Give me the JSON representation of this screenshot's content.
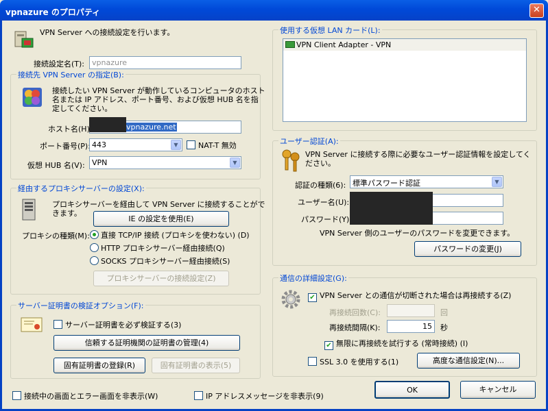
{
  "window": {
    "title": "vpnazure のプロパティ",
    "close_glyph": "✕"
  },
  "intro": "VPN Server への接続設定を行います。",
  "setting_name": {
    "label": "接続設定名(T):",
    "value": "vpnazure"
  },
  "dest": {
    "legend": "接続先 VPN Server の指定(B):",
    "desc": [
      "接続したい VPN Server が動作しているコンピュータのホスト",
      "名または IP アドレス、ポート番号、および仮想 HUB 名を指",
      "定してください。"
    ],
    "host_label": "ホスト名(H):",
    "host_value": "vpnazure.net",
    "port_label": "ポート番号(P):",
    "port_value": "443",
    "natt_label": "NAT-T 無効",
    "hub_label": "仮想 HUB 名(V):",
    "hub_value": "VPN"
  },
  "proxy": {
    "legend": "経由するプロキシサーバーの設定(X):",
    "desc": [
      "プロキシサーバーを経由して VPN Server に接続することがで",
      "きます。"
    ],
    "ie_button": "IE の設定を使用(E)",
    "type_label": "プロキシの種類(M):",
    "options": [
      "直接 TCP/IP 接続 (プロキシを使わない) (D)",
      "HTTP プロキシサーバー経由接続(Q)",
      "SOCKS プロキシサーバー経由接続(S)"
    ],
    "settings_button": "プロキシサーバーの接続設定(Z)"
  },
  "cert": {
    "legend": "サーバー証明書の検証オプション(F):",
    "verify_label": "サーバー証明書を必ず検証する(3)",
    "manage_button": "信頼する証明機関の証明書の管理(4)",
    "register_button": "固有証明書の登録(R)",
    "show_button": "固有証明書の表示(5)"
  },
  "bottom": {
    "hide_screens_label": "接続中の画面とエラー画面を非表示(W)",
    "hide_ip_label": "IP アドレスメッセージを非表示(9)"
  },
  "lan": {
    "legend": "使用する仮想 LAN カード(L):",
    "items": [
      "VPN Client Adapter - VPN"
    ]
  },
  "auth": {
    "legend": "ユーザー認証(A):",
    "desc": [
      "VPN Server に接続する際に必要なユーザー認証情報を設定してく",
      "ださい。"
    ],
    "type_label": "認証の種類(6):",
    "type_value": "標準パスワード認証",
    "user_label": "ユーザー名(U):",
    "password_label": "パスワード(Y):",
    "change_desc": "VPN Server 側のユーザーのパスワードを変更できます。",
    "change_button": "パスワードの変更(J)"
  },
  "comm": {
    "legend": "通信の詳細設定(G):",
    "reconnect_label": "VPN Server との通信が切断された場合は再接続する(Z)",
    "retry_count_label": "再接続回数(C):",
    "retry_count_unit": "回",
    "interval_label": "再接続間隔(K):",
    "interval_value": "15",
    "interval_unit": "秒",
    "infinite_label": "無限に再接続を試行する (常時接続) (I)",
    "ssl_label": "SSL 3.0 を使用する(1)",
    "advanced_button": "高度な通信設定(N)..."
  },
  "footer": {
    "ok": "OK",
    "cancel": "キャンセル"
  }
}
